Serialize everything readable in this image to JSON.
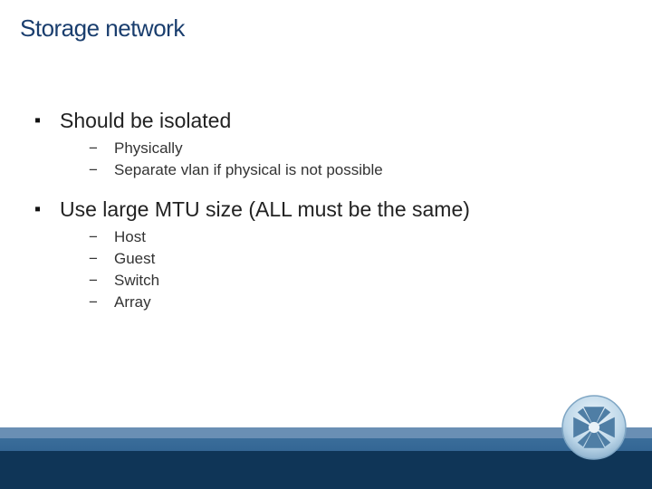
{
  "title": "Storage network",
  "bullets": [
    {
      "text": "Should be isolated",
      "subs": [
        "Physically",
        "Separate vlan if physical is not possible"
      ]
    },
    {
      "text": "Use large MTU size (ALL must be the same)",
      "subs": [
        "Host",
        "Guest",
        "Switch",
        "Array"
      ]
    }
  ]
}
